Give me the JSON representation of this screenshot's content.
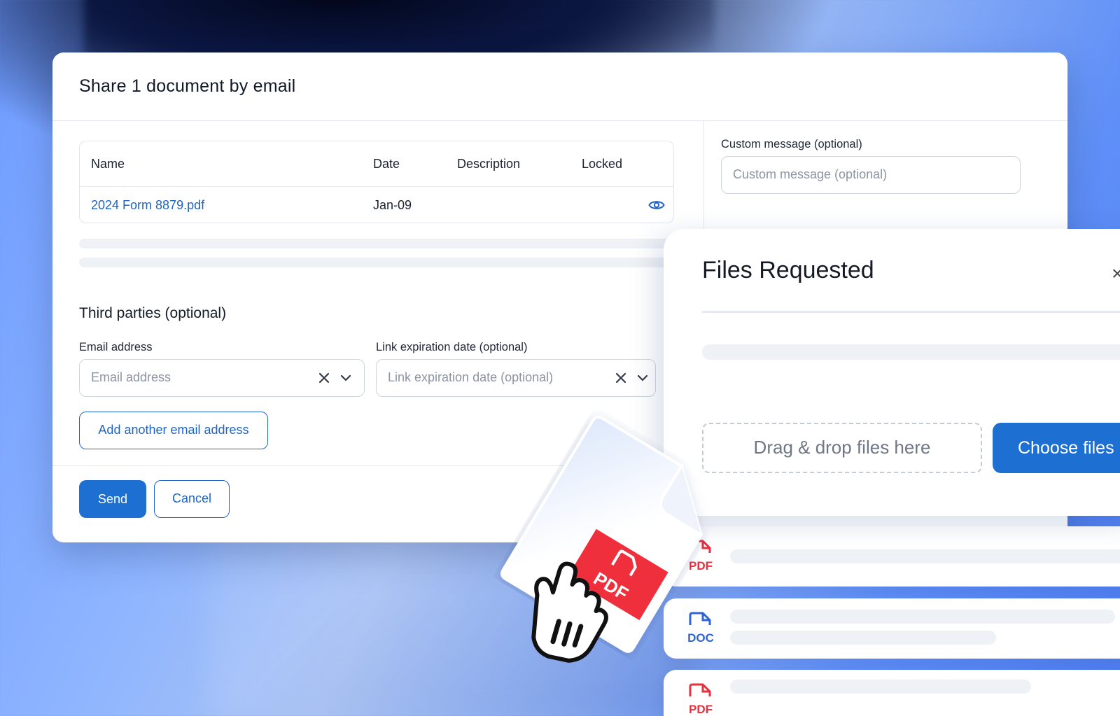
{
  "dialog": {
    "title": "Share 1 document by email",
    "table": {
      "headers": {
        "name": "Name",
        "date": "Date",
        "description": "Description",
        "locked": "Locked"
      },
      "rows": [
        {
          "name": "2024 Form 8879.pdf",
          "date": "Jan-09",
          "description": ""
        }
      ]
    },
    "custom_message": {
      "label": "Custom message (optional)",
      "placeholder": "Custom message (optional)"
    },
    "third_parties": {
      "title": "Third parties (optional)",
      "email": {
        "label": "Email address",
        "placeholder": "Email address"
      },
      "expiration": {
        "label": "Link expiration date (optional)",
        "placeholder": "Link expiration date (optional)"
      },
      "add_email_label": "Add another email address"
    },
    "footer": {
      "send_label": "Send",
      "cancel_label": "Cancel"
    }
  },
  "files_panel": {
    "title": "Files Requested",
    "close_glyph": "×",
    "dropzone_label": "Drag & drop files here",
    "choose_label": "Choose files",
    "files": [
      {
        "type_label": "PDF",
        "color": "#e8303f"
      },
      {
        "type_label": "DOC",
        "color": "#2f64d8"
      },
      {
        "type_label": "PDF",
        "color": "#e8303f"
      }
    ]
  },
  "floating_doc": {
    "badge": "PDF",
    "badge_color": "#ef2f3c"
  },
  "colors": {
    "accent": "#1d6fd1",
    "link": "#1f64c4"
  }
}
